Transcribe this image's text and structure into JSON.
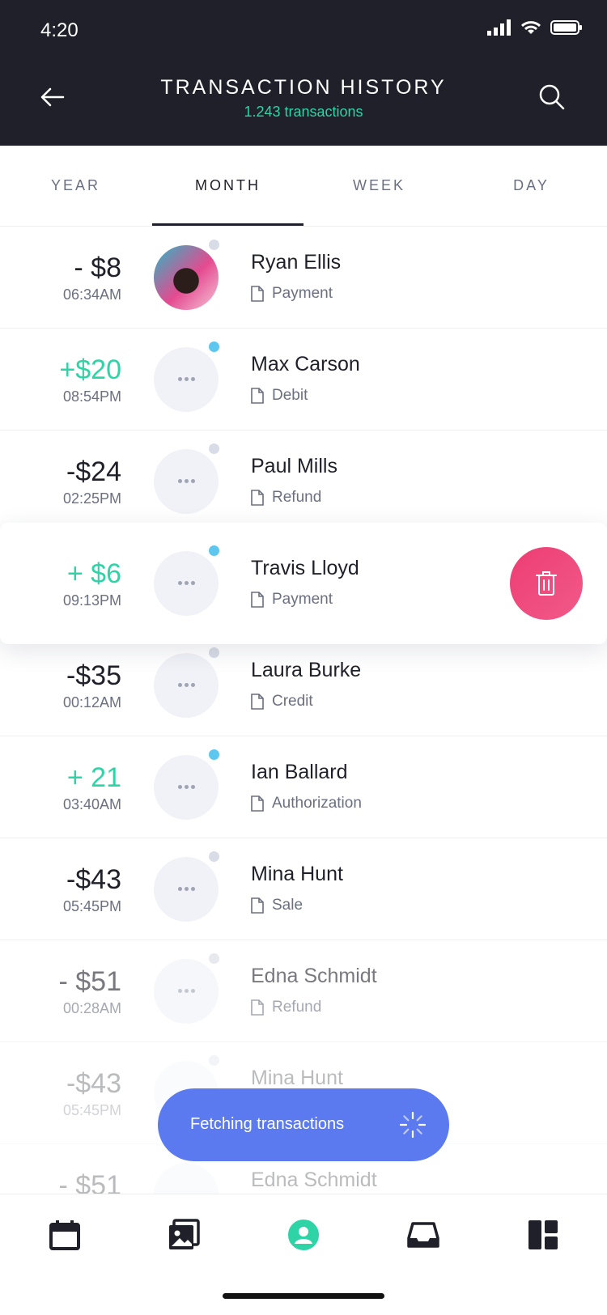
{
  "status_bar": {
    "time": "4:20"
  },
  "header": {
    "title": "TRANSACTION HISTORY",
    "subtitle": "1.243 transactions"
  },
  "tabs": [
    {
      "label": "YEAR"
    },
    {
      "label": "MONTH",
      "active": true
    },
    {
      "label": "WEEK"
    },
    {
      "label": "DAY"
    }
  ],
  "transactions": [
    {
      "amount": "- $8",
      "time": "06:34AM",
      "name": "Ryan Ellis",
      "type": "Payment"
    },
    {
      "amount": "+$20",
      "time": "08:54PM",
      "name": "Max Carson",
      "type": "Debit"
    },
    {
      "amount": "-$24",
      "time": "02:25PM",
      "name": "Paul Mills",
      "type": "Refund"
    },
    {
      "amount": "+ $6",
      "time": "09:13PM",
      "name": "Travis Lloyd",
      "type": "Payment"
    },
    {
      "amount": "-$35",
      "time": "00:12AM",
      "name": "Laura Burke",
      "type": "Credit"
    },
    {
      "amount": "+ 21",
      "time": "03:40AM",
      "name": "Ian Ballard",
      "type": "Authorization"
    },
    {
      "amount": "-$43",
      "time": "05:45PM",
      "name": "Mina Hunt",
      "type": "Sale"
    },
    {
      "amount": "- $51",
      "time": "00:28AM",
      "name": "Edna Schmidt",
      "type": "Refund"
    },
    {
      "amount": "-$43",
      "time": "05:45PM",
      "name": "Mina Hunt",
      "type": ""
    },
    {
      "amount": "- $51",
      "time": "",
      "name": "Edna Schmidt",
      "type": ""
    }
  ],
  "toast": {
    "text": "Fetching transactions"
  },
  "nav": [
    "calendar-icon",
    "gallery-icon",
    "profile-icon",
    "inbox-icon",
    "dashboard-icon"
  ],
  "colors": {
    "header_bg": "#1f2029",
    "accent_green": "#2ed3a6",
    "toast_blue": "#5c7af0",
    "delete_pink": "#ee3d73"
  }
}
